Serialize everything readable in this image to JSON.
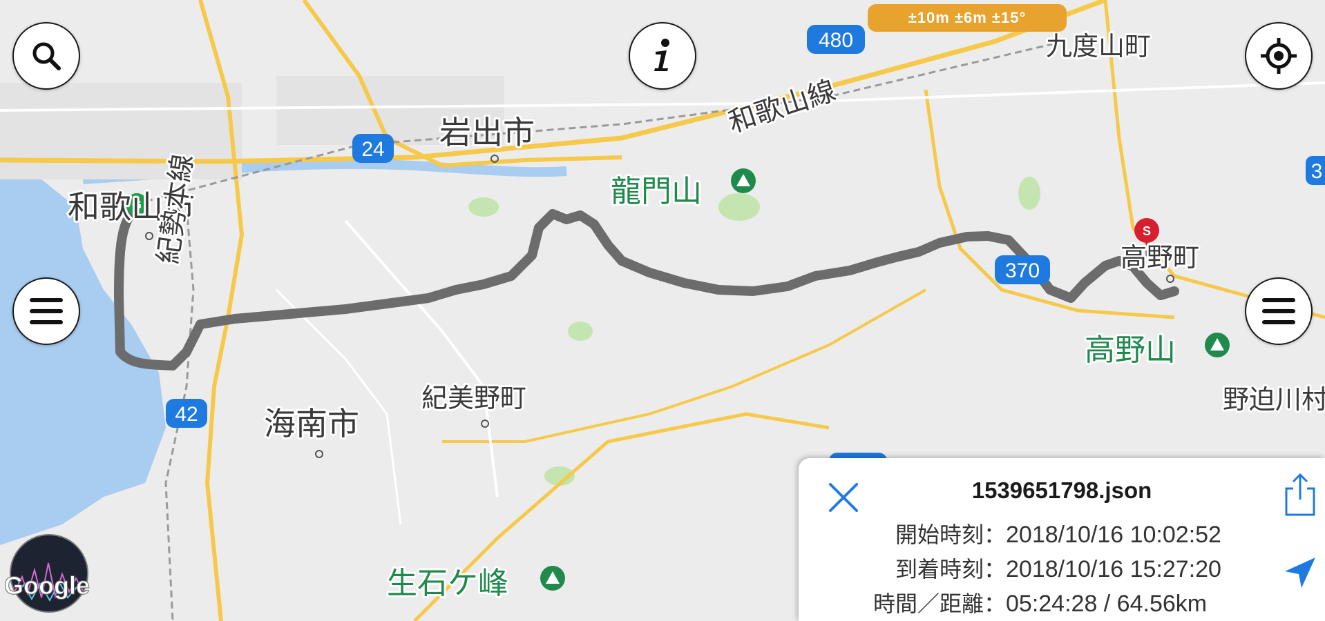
{
  "map": {
    "places": [
      {
        "name": "和歌山市",
        "kind": "city"
      },
      {
        "name": "岩出市",
        "kind": "city"
      },
      {
        "name": "海南市",
        "kind": "city"
      },
      {
        "name": "紀美野町",
        "kind": "town"
      },
      {
        "name": "高野町",
        "kind": "town"
      },
      {
        "name": "九度山町",
        "kind": "town"
      },
      {
        "name": "野迫川村",
        "kind": "town-partial"
      },
      {
        "name": "龍門山",
        "kind": "mountain"
      },
      {
        "name": "高野山",
        "kind": "mountain"
      },
      {
        "name": "生石ケ峰",
        "kind": "mountain"
      },
      {
        "name": "和歌山線",
        "kind": "rail"
      },
      {
        "name": "紀勢本線",
        "kind": "rail"
      }
    ],
    "routes": [
      "24",
      "42",
      "370",
      "480",
      "370",
      "370",
      "3"
    ],
    "colors": {
      "land": "#ececec",
      "water": "#a8cdf0",
      "major_road": "#f6c94a",
      "track": "#6c6c6c",
      "park": "#c4e5b0",
      "start_pin": "#1e9e4a",
      "end_pin": "#d6202f",
      "accent": "#1f7ae0",
      "accuracy_badge": "#e8a22e"
    },
    "pins": {
      "goal": "G",
      "start": "S"
    },
    "attribution": "Google"
  },
  "accuracy_text": "±10m ±6m ±15°",
  "buttons": {
    "search_icon": "search-icon",
    "info_icon": "info-icon",
    "locate_icon": "crosshair-icon",
    "menu_icon": "hamburger-icon"
  },
  "panel": {
    "filename": "1539651798.json",
    "rows": [
      {
        "label": "開始時刻：",
        "value": "2018/10/16 10:02:52"
      },
      {
        "label": "到着時刻：",
        "value": "2018/10/16 15:27:20"
      },
      {
        "label": "時間／距離：",
        "value": "05:24:28 / 64.56km"
      }
    ],
    "close_icon": "close-icon",
    "share_icon": "share-icon",
    "navigate_icon": "navigation-arrow-icon"
  }
}
